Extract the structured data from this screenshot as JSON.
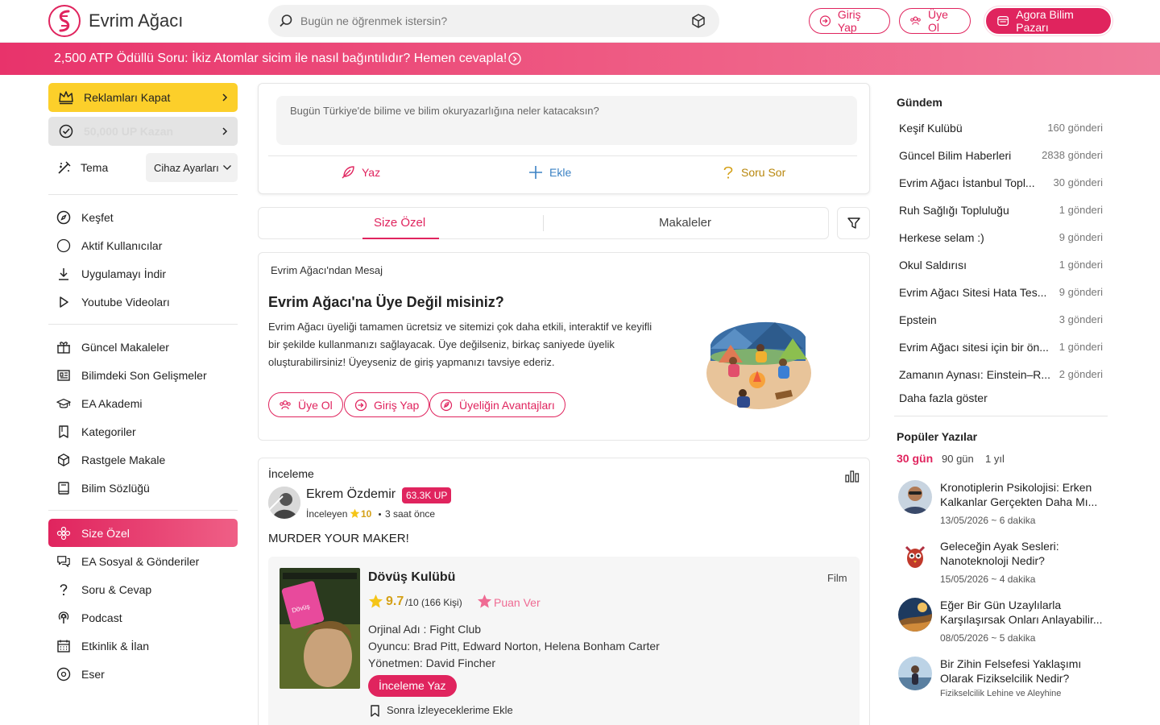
{
  "header": {
    "brand": "Evrim Ağacı",
    "search_placeholder": "Bugün ne öğrenmek istersin?",
    "login": "Giriş Yap",
    "signup": "Üye Ol",
    "agora": "Agora Bilim Pazarı"
  },
  "banner": {
    "text": "2,500 ATP Ödüllü Soru: İkiz Atomlar sicim ile nasıl bağıntılıdır? Hemen cevapla!"
  },
  "sidebar": {
    "ads_button": "Reklamları Kapat",
    "up_button": "50,000 UP Kazan",
    "theme_label": "Tema",
    "theme_value": "Cihaz Ayarları",
    "group1": [
      "Keşfet",
      "Aktif Kullanıcılar",
      "Uygulamayı İndir",
      "Youtube Videoları"
    ],
    "group2": [
      "Güncel Makaleler",
      "Bilimdeki Son Gelişmeler",
      "EA Akademi",
      "Kategoriler",
      "Rastgele Makale",
      "Bilim Sözlüğü"
    ],
    "group3": [
      "Size Özel",
      "EA Sosyal & Gönderiler",
      "Soru & Cevap",
      "Podcast",
      "Etkinlik & İlan",
      "Eser"
    ]
  },
  "composer": {
    "placeholder": "Bugün Türkiye'de bilime ve bilim okuryazarlığına neler katacaksın?",
    "write": "Yaz",
    "add": "Ekle",
    "ask": "Soru Sor"
  },
  "tabs": {
    "personal": "Size Özel",
    "articles": "Makaleler"
  },
  "message_card": {
    "label": "Evrim Ağacı'ndan Mesaj",
    "title": "Evrim Ağacı'na Üye Değil misiniz?",
    "body": "Evrim Ağacı üyeliği tamamen ücretsiz ve sitemizi çok daha etkili, interaktif ve keyifli bir şekilde kullanmanızı sağlayacak. Üye değilseniz, birkaç saniyede üyelik oluşturabilirsiniz! Üyeyseniz de giriş yapmanızı tavsiye ederiz.",
    "signup": "Üye Ol",
    "login": "Giriş Yap",
    "benefits": "Üyeliğin Avantajları"
  },
  "review": {
    "label": "İnceleme",
    "author": "Ekrem Özdemir",
    "up_badge": "63.3K UP",
    "role": "İnceleyen",
    "rating_given": "10",
    "time": "3 saat önce",
    "headline": "MURDER YOUR MAKER!",
    "movie": {
      "title": "Dövüş Kulübü",
      "type": "Film",
      "score": "9.7",
      "score_suffix": "/10 (166 Kişi)",
      "rate_label": "Puan Ver",
      "original": "Orjinal Adı : Fight Club",
      "cast_label": "Oyuncu:",
      "cast": "Brad Pitt, Edward Norton, Helena Bonham Carter",
      "director_label": "Yönetmen:",
      "director": "David Fincher",
      "write_review": "İnceleme Yaz",
      "watchlist": "Sonra İzleyeceklerime Ekle"
    }
  },
  "agenda": {
    "title": "Gündem",
    "items": [
      {
        "name": "Keşif Kulübü",
        "count": "160 gönderi"
      },
      {
        "name": "Güncel Bilim Haberleri",
        "count": "2838 gönderi"
      },
      {
        "name": "Evrim Ağacı İstanbul Topl...",
        "count": "30 gönderi"
      },
      {
        "name": "Ruh Sağlığı Topluluğu",
        "count": "1 gönderi"
      },
      {
        "name": "Herkese selam :)",
        "count": "9 gönderi"
      },
      {
        "name": "Okul Saldırısı",
        "count": "1 gönderi"
      },
      {
        "name": "Evrim Ağacı Sitesi Hata Tes...",
        "count": "9 gönderi"
      },
      {
        "name": "Epstein",
        "count": "3 gönderi"
      },
      {
        "name": "Evrim Ağacı sitesi için bir ön...",
        "count": "1 gönderi"
      },
      {
        "name": "Zamanın Aynası: Einstein–R...",
        "count": "2 gönderi"
      }
    ],
    "more": "Daha fazla göster"
  },
  "popular": {
    "title": "Popüler Yazılar",
    "periods": [
      "30 gün",
      "90 gün",
      "1 yıl"
    ],
    "items": [
      {
        "title": "Kronotiplerin Psikolojisi: Erken Kalkanlar Gerçekten Daha Mı...",
        "meta": "13/05/2026 ~ 6 dakika"
      },
      {
        "title": "Geleceğin Ayak Sesleri: Nanoteknoloji Nedir?",
        "meta": "15/05/2026 ~ 4 dakika"
      },
      {
        "title": "Eğer Bir Gün Uzaylılarla Karşılaşırsak Onları Anlayabilir...",
        "meta": "08/05/2026 ~ 5 dakika"
      },
      {
        "title": "Bir Zihin Felsefesi Yaklaşımı Olarak Fizikselcilik Nedir?",
        "meta": "Fizikselcilik Lehine ve Aleyhine"
      }
    ]
  },
  "colors": {
    "accent": "#e0245e",
    "gold": "#f5c518",
    "yellow_btn": "#fccf2a"
  }
}
